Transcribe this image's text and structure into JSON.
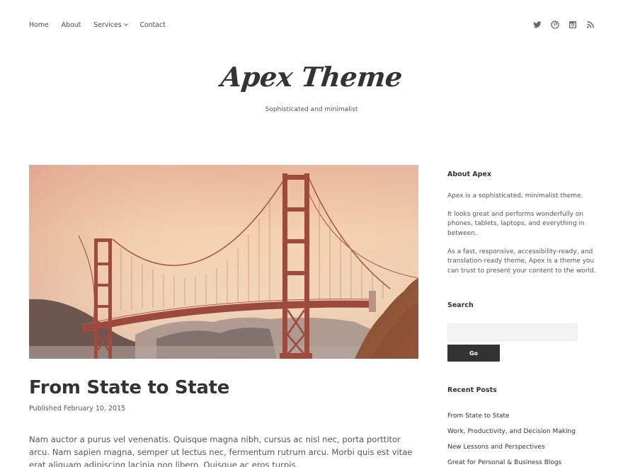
{
  "nav": {
    "items": [
      {
        "label": "Home"
      },
      {
        "label": "About"
      },
      {
        "label": "Services",
        "has_submenu": true
      },
      {
        "label": "Contact"
      }
    ]
  },
  "social": {
    "icons": [
      "twitter-icon",
      "pinterest-icon",
      "instagram-icon",
      "rss-icon"
    ]
  },
  "header": {
    "title": "Apex Theme",
    "tagline": "Sophisticated and minimalist"
  },
  "post": {
    "featured_image_alt": "Golden Gate Bridge at sunset",
    "title": "From State to State",
    "meta": "Published February 10, 2015",
    "excerpt": "Nam auctor a purus vel venenatis. Quisque magna nibh, cursus ac nisl nec, porta porttitor arcu. Nam sapien magna, semper ut lectus nec, fermentum rutrum arcu. Morbi quis est vitae erat aliquam adipiscing lacinia non libero. Quisque ac eros turpis."
  },
  "sidebar": {
    "about": {
      "title": "About Apex",
      "paragraphs": [
        "Apex is a sophisticated, minimalist theme.",
        "It looks great and performs wonderfully on phones, tablets, laptops, and everything in between.",
        "As a fast, responsive, accessibility-ready, and translation-ready theme, Apex is a theme you can trust to present your content to the world."
      ]
    },
    "search": {
      "title": "Search",
      "value": "",
      "placeholder": "",
      "button_label": "Go"
    },
    "recent_posts": {
      "title": "Recent Posts",
      "items": [
        "From State to State",
        "Work, Productivity, and Decision Making",
        "New Lessons and Perspectives",
        "Great for Personal & Business Blogs"
      ]
    }
  },
  "colors": {
    "text": "#333333",
    "muted": "#555555",
    "button_bg": "#333333",
    "input_bg": "#f3f3f3",
    "bridge": "#a04a3e"
  }
}
